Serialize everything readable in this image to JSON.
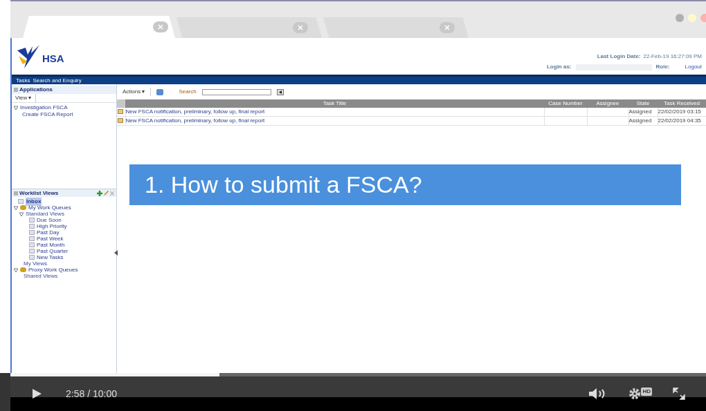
{
  "browser_tabs": [
    {
      "selected": true
    },
    {
      "selected": false
    },
    {
      "selected": false
    }
  ],
  "header": {
    "logo_text": "HSA",
    "last_login_label": "Last Login Date:",
    "last_login_value": "22-Feb-19 16:27:09 PM",
    "login_as_label": "Login as:",
    "role_label": "Role:",
    "logout": "Logout"
  },
  "nav": {
    "items": [
      "Tasks",
      "Search and Enquiry"
    ]
  },
  "applications": {
    "title": "Applications",
    "view_button": "View ▾",
    "tree": [
      {
        "label": "Investigation FSCA",
        "expanded": true,
        "children": [
          {
            "label": "Create FSCA Report"
          }
        ]
      }
    ]
  },
  "worklist_views": {
    "title": "Worklist Views",
    "items": [
      {
        "label": "Inbox",
        "kind": "view",
        "selected": true
      },
      {
        "label": "My Work Queues",
        "kind": "queue",
        "selected": false,
        "children": [
          {
            "label": "Standard Views",
            "kind": "folder",
            "selected": false,
            "children": [
              {
                "label": "Due Soon",
                "kind": "view",
                "selected": false
              },
              {
                "label": "High Priority",
                "kind": "view",
                "selected": false
              },
              {
                "label": "Past Day",
                "kind": "view",
                "selected": false
              },
              {
                "label": "Past Week",
                "kind": "view",
                "selected": false
              },
              {
                "label": "Past Month",
                "kind": "view",
                "selected": false
              },
              {
                "label": "Past Quarter",
                "kind": "view",
                "selected": false
              },
              {
                "label": "New Tasks",
                "kind": "view",
                "selected": false
              }
            ]
          },
          {
            "label": "My Views",
            "kind": "folder",
            "selected": false
          }
        ]
      },
      {
        "label": "Proxy Work Queues",
        "kind": "queue",
        "selected": false,
        "children": [
          {
            "label": "Shared Views",
            "kind": "folder",
            "selected": false
          }
        ]
      }
    ]
  },
  "toolbar": {
    "actions": "Actions ▾",
    "search_label": "Search"
  },
  "table": {
    "columns": [
      "Task Title",
      "Case Number",
      "Assignee",
      "State",
      "Task Received"
    ],
    "rows": [
      [
        "New FSCA notification, preliminary, follow up, final report",
        "",
        "",
        "Assigned",
        "22/02/2019 03:15"
      ],
      [
        "New FSCA notification, preliminary, follow up, final report",
        "",
        "",
        "Assigned",
        "22/02/2019 04:35"
      ]
    ]
  },
  "banner": {
    "title": "1. How to submit a FSCA?"
  },
  "player": {
    "time": "2:58 / 10:00",
    "progress": {
      "level": 0.3
    },
    "hd_badge": "HD"
  }
}
